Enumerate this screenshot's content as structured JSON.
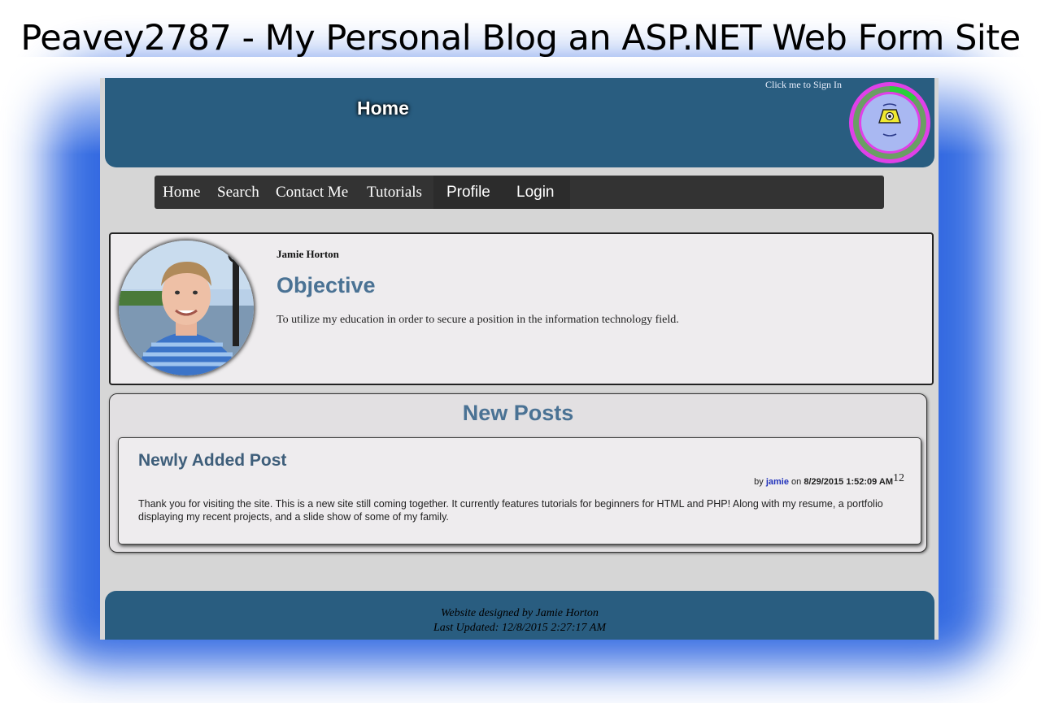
{
  "banner": {
    "title": "Peavey2787 - My Personal Blog an ASP.NET Web Form Site"
  },
  "header": {
    "title": "Home",
    "signin_link": "Click me to Sign In"
  },
  "nav": {
    "items": [
      {
        "label": "Home"
      },
      {
        "label": "Search"
      },
      {
        "label": "Contact Me"
      },
      {
        "label": "Tutorials"
      },
      {
        "label": "Profile"
      },
      {
        "label": "Login"
      }
    ]
  },
  "profile": {
    "name": "Jamie Horton",
    "heading": "Objective",
    "objective": "To utilize my education in order to secure a position in the information technology field."
  },
  "posts": {
    "heading": "New Posts",
    "items": [
      {
        "title": "Newly Added Post",
        "by_label": "by",
        "author": "jamie",
        "on_label": "on",
        "date": "8/29/2015 1:52:09 AM",
        "count": "12",
        "body": "Thank you for visiting the site. This is a new site still coming together. It currently features tutorials for beginners for HTML and PHP! Along with my resume, a portfolio displaying my recent projects, and a slide show of some of my family."
      }
    ]
  },
  "footer": {
    "designed_by": "Website designed by Jamie Horton",
    "last_updated": "Last Updated: 12/8/2015 2:27:17 AM"
  },
  "colors": {
    "header_bg": "#295d80",
    "nav_bg": "#333333",
    "heading_blue": "#4a7294",
    "glow_blue": "#2a63e0"
  }
}
